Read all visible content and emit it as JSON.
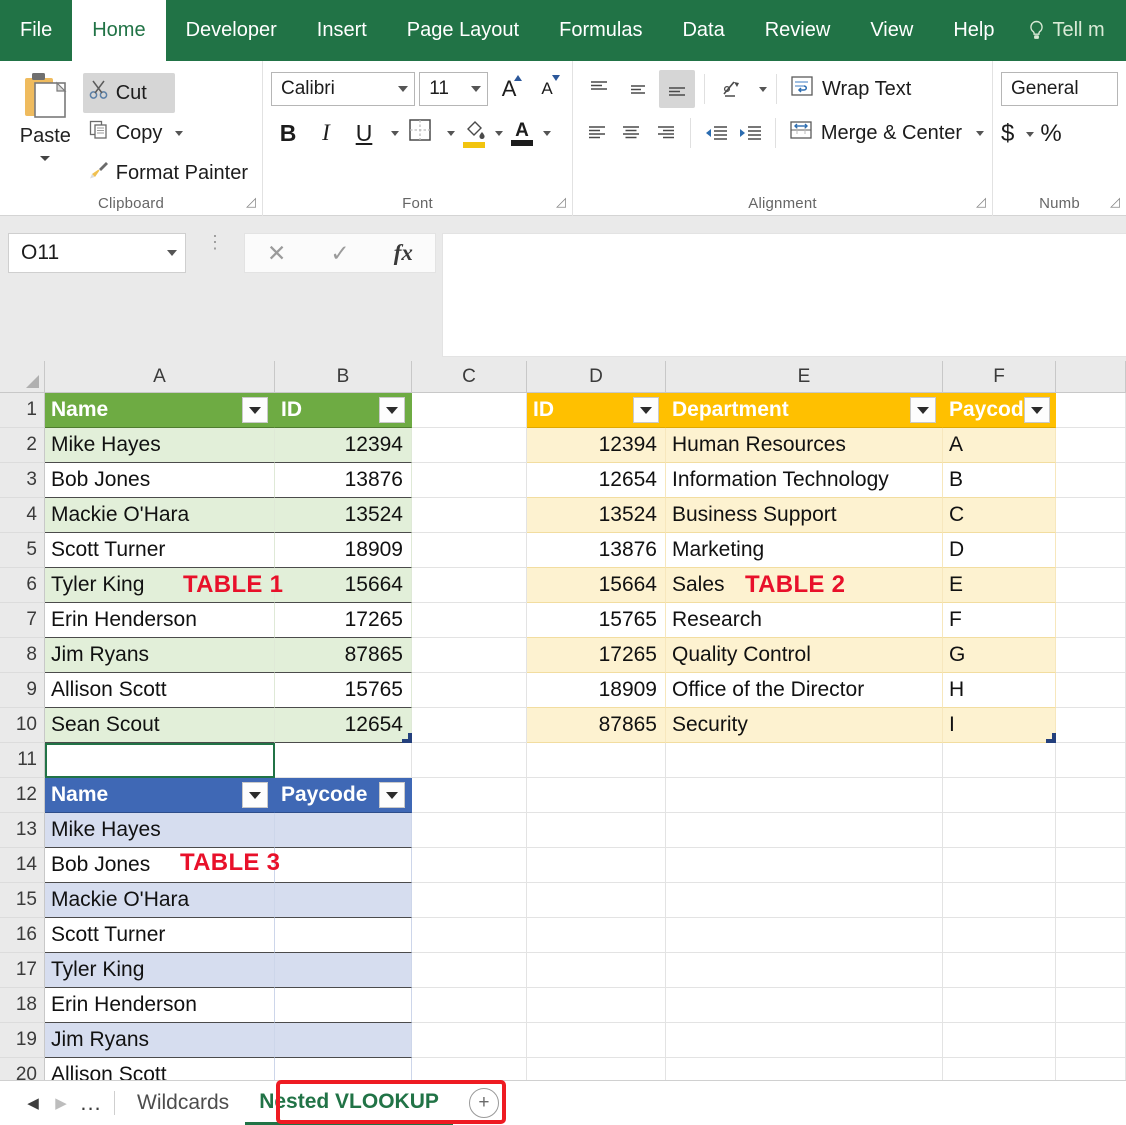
{
  "ribbon": {
    "tabs": [
      {
        "label": "File",
        "active": false
      },
      {
        "label": "Home",
        "active": true
      },
      {
        "label": "Developer",
        "active": false
      },
      {
        "label": "Insert",
        "active": false
      },
      {
        "label": "Page Layout",
        "active": false
      },
      {
        "label": "Formulas",
        "active": false
      },
      {
        "label": "Data",
        "active": false
      },
      {
        "label": "Review",
        "active": false
      },
      {
        "label": "View",
        "active": false
      },
      {
        "label": "Help",
        "active": false
      }
    ],
    "tell_me": "Tell m",
    "accent_color": "#217346",
    "groups": {
      "clipboard": {
        "label": "Clipboard",
        "paste": "Paste",
        "cut": "Cut",
        "copy": "Copy",
        "format_painter": "Format Painter"
      },
      "font": {
        "label": "Font",
        "font_name": "Calibri",
        "font_size": "11",
        "bold": "B",
        "italic": "I",
        "underline": "U"
      },
      "alignment": {
        "label": "Alignment",
        "wrap_text": "Wrap Text",
        "merge_center": "Merge & Center"
      },
      "number": {
        "label": "Numb",
        "format": "General",
        "currency": "$",
        "percent": "%"
      }
    }
  },
  "formula_bar": {
    "name_box": "O11",
    "formula": ""
  },
  "grid": {
    "columns": [
      "A",
      "B",
      "C",
      "D",
      "E",
      "F"
    ],
    "rows": [
      "1",
      "2",
      "3",
      "4",
      "5",
      "6",
      "7",
      "8",
      "9",
      "10",
      "11",
      "12",
      "13",
      "14",
      "15",
      "16",
      "17",
      "18",
      "19",
      "20"
    ],
    "annotations": {
      "table1": "TABLE 1",
      "table2": "TABLE 2",
      "table3": "TABLE 3",
      "annotation_color": "#e8102a"
    },
    "table1": {
      "header_color": "#6eab43",
      "headers": [
        "Name",
        "ID"
      ],
      "rows": [
        {
          "name": "Mike Hayes",
          "id": "12394"
        },
        {
          "name": "Bob Jones",
          "id": "13876"
        },
        {
          "name": "Mackie O'Hara",
          "id": "13524"
        },
        {
          "name": "Scott Turner",
          "id": "18909"
        },
        {
          "name": "Tyler King",
          "id": "15664"
        },
        {
          "name": "Erin Henderson",
          "id": "17265"
        },
        {
          "name": "Jim Ryans",
          "id": "87865"
        },
        {
          "name": "Allison Scott",
          "id": "15765"
        },
        {
          "name": "Sean Scout",
          "id": "12654"
        }
      ]
    },
    "table2": {
      "header_color": "#ffc000",
      "headers": [
        "ID",
        "Department",
        "Paycod"
      ],
      "rows": [
        {
          "id": "12394",
          "department": "Human Resources",
          "paycode": "A"
        },
        {
          "id": "12654",
          "department": "Information Technology",
          "paycode": "B"
        },
        {
          "id": "13524",
          "department": "Business Support",
          "paycode": "C"
        },
        {
          "id": "13876",
          "department": "Marketing",
          "paycode": "D"
        },
        {
          "id": "15664",
          "department": "Sales",
          "paycode": "E"
        },
        {
          "id": "15765",
          "department": "Research",
          "paycode": "F"
        },
        {
          "id": "17265",
          "department": "Quality Control",
          "paycode": "G"
        },
        {
          "id": "18909",
          "department": "Office of the Director",
          "paycode": "H"
        },
        {
          "id": "87865",
          "department": "Security",
          "paycode": "I"
        }
      ]
    },
    "table3": {
      "header_color": "#3f68b5",
      "headers": [
        "Name",
        "Paycode"
      ],
      "rows": [
        {
          "name": "Mike Hayes",
          "paycode": ""
        },
        {
          "name": "Bob Jones",
          "paycode": ""
        },
        {
          "name": "Mackie O'Hara",
          "paycode": ""
        },
        {
          "name": "Scott Turner",
          "paycode": ""
        },
        {
          "name": "Tyler King",
          "paycode": ""
        },
        {
          "name": "Erin Henderson",
          "paycode": ""
        },
        {
          "name": "Jim Ryans",
          "paycode": ""
        },
        {
          "name": "Allison Scott",
          "paycode": ""
        }
      ]
    }
  },
  "sheet_tabs": {
    "ellipsis": "...",
    "tabs": [
      {
        "label": "Wildcards",
        "active": false
      },
      {
        "label": "Nested VLOOKUP",
        "active": true
      }
    ],
    "add_label": "+",
    "highlight_color": "#ee1b22"
  }
}
